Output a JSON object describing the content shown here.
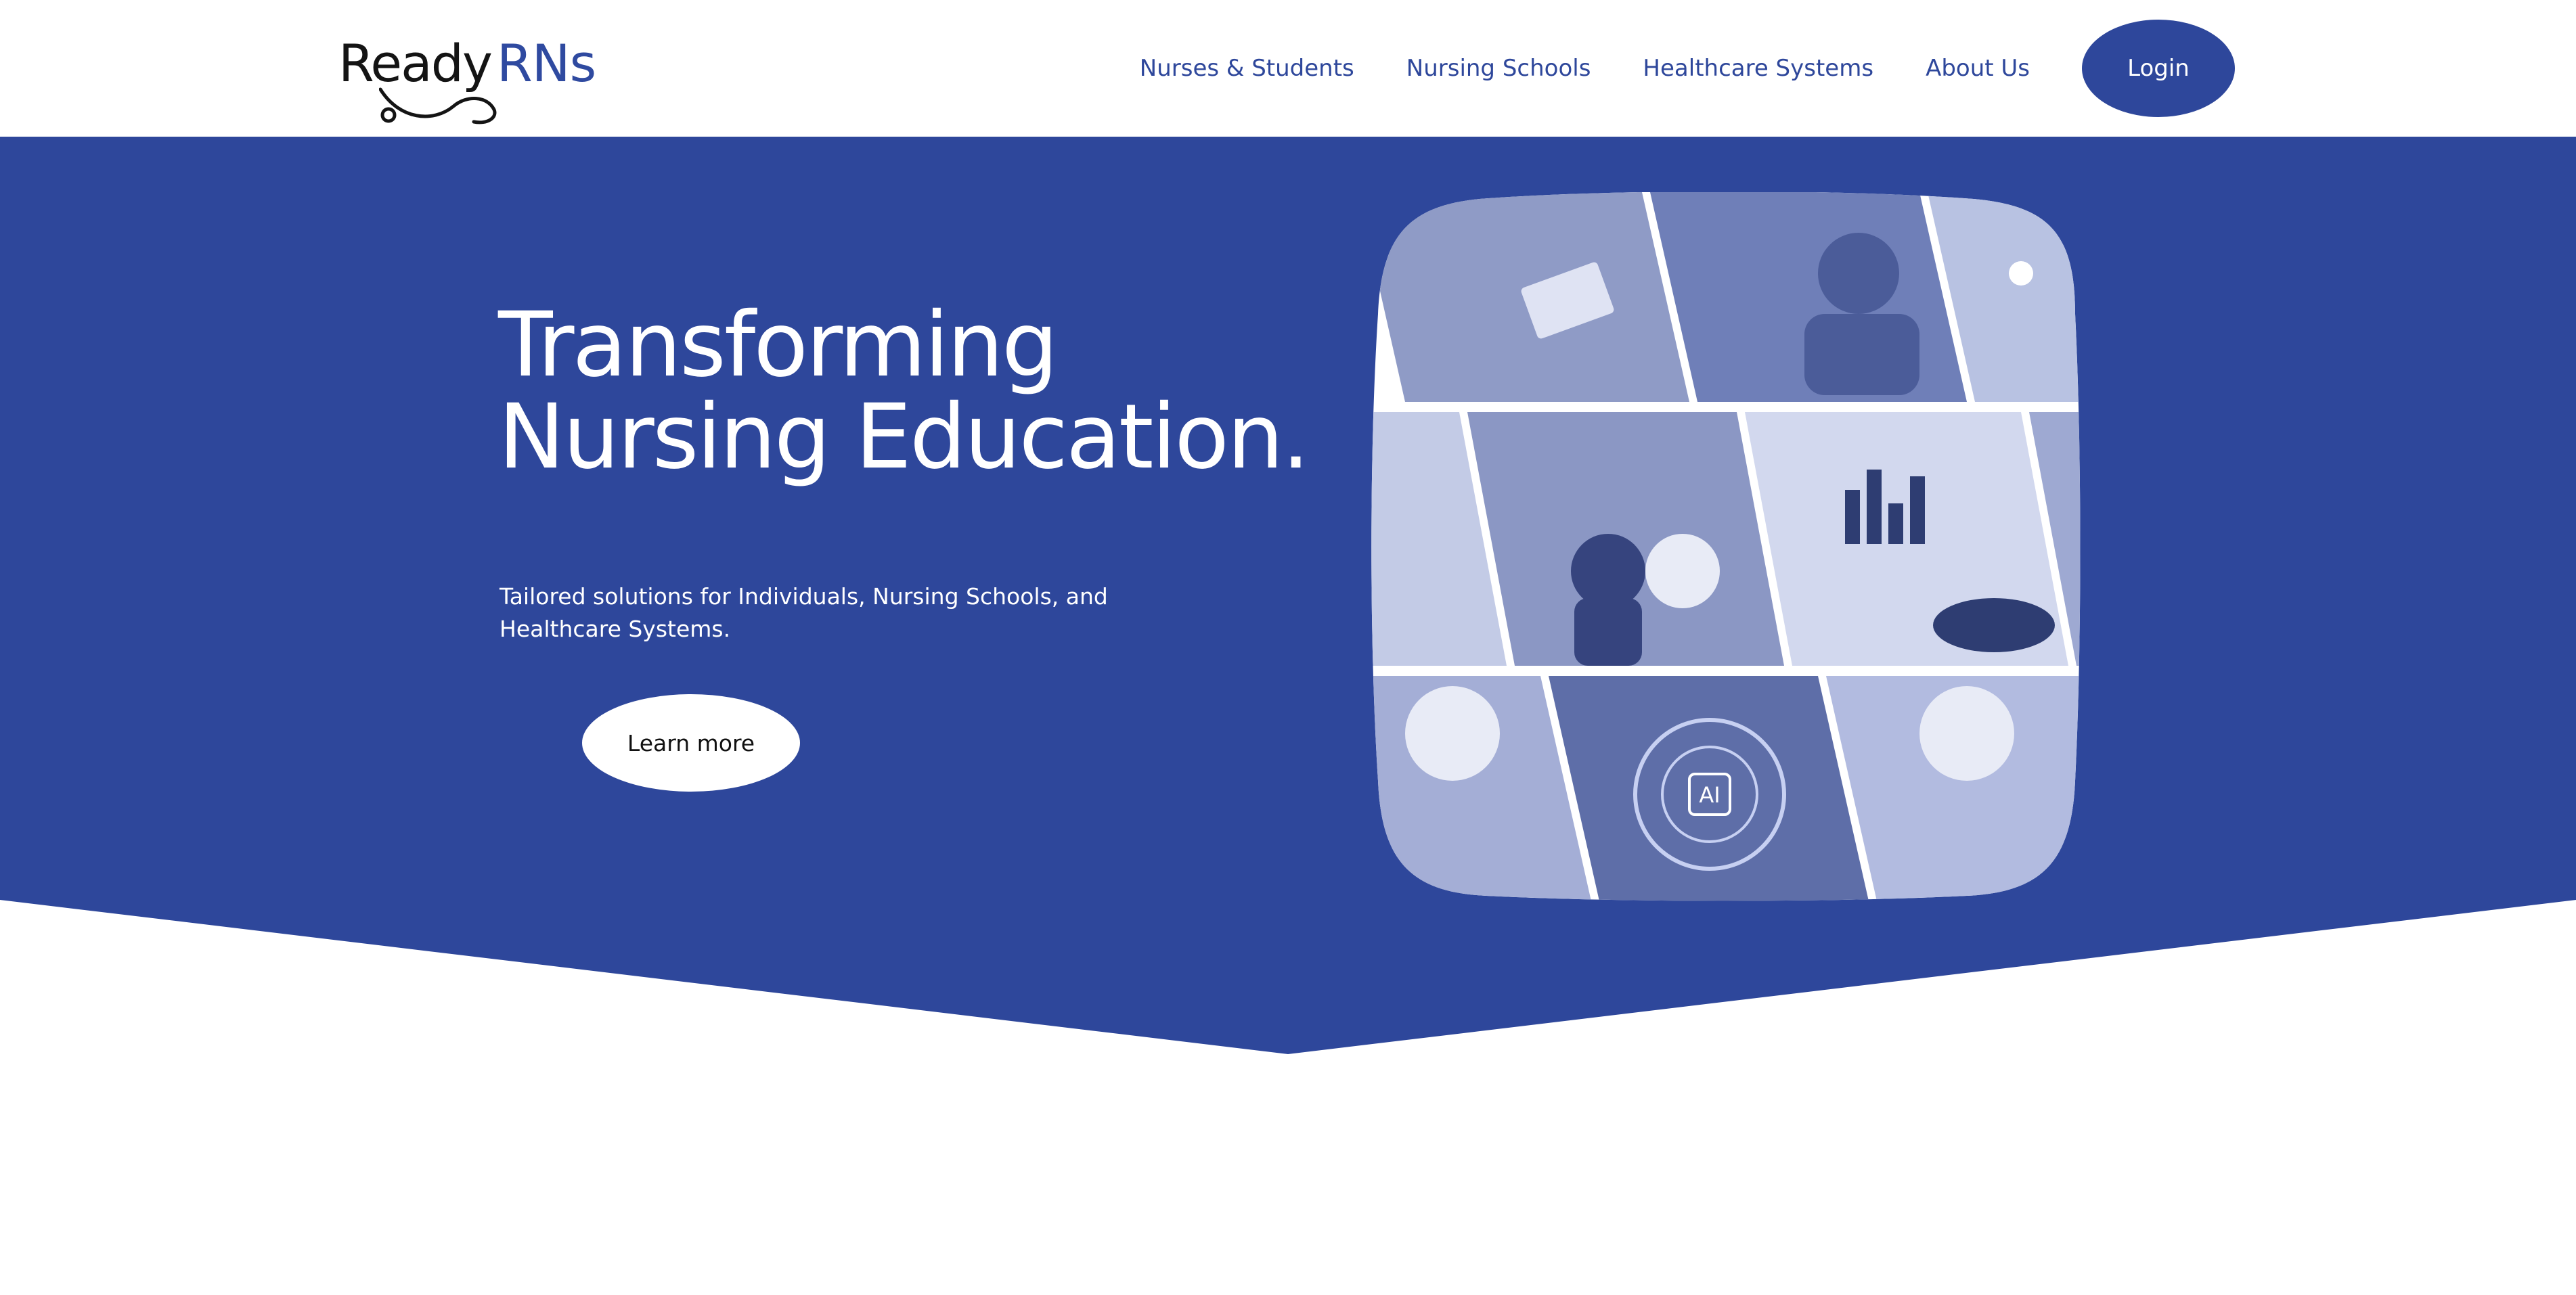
{
  "header": {
    "logo": {
      "ready": "Ready",
      "rns": "RNs"
    },
    "nav": [
      {
        "label": "Nurses & Students"
      },
      {
        "label": "Nursing Schools"
      },
      {
        "label": "Healthcare Systems"
      },
      {
        "label": "About Us"
      }
    ],
    "login_label": "Login"
  },
  "hero": {
    "headline_line1": "Transforming",
    "headline_line2": "Nursing Education.",
    "subtitle_line1": "Tailored solutions for Individuals, Nursing Schools, and",
    "subtitle_line2": "Healthcare Systems.",
    "cta_label": "Learn more",
    "collage_badge": "AI"
  },
  "colors": {
    "brand_blue": "#2e479b",
    "hero_blue": "#2e479b",
    "white": "#ffffff",
    "logo_black": "#141414"
  },
  "icons": {
    "logo_mark": "stethoscope-swoosh-icon"
  }
}
